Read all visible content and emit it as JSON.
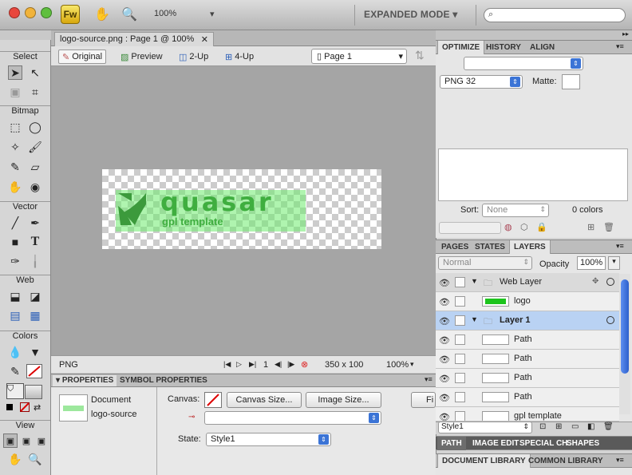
{
  "titlebar": {
    "app_logo": "Fw",
    "zoom": "100%",
    "workspace": "EXPANDED MODE ▾",
    "icons": [
      "hand-icon",
      "zoom-icon"
    ]
  },
  "toolbox": {
    "select": "Select",
    "bitmap": "Bitmap",
    "vector": "Vector",
    "web": "Web",
    "colors": "Colors",
    "view": "View"
  },
  "document": {
    "tab_title": "logo-source.png : Page 1 @ 100%",
    "views": [
      "Original",
      "Preview",
      "2-Up",
      "4-Up"
    ],
    "page": "Page 1",
    "logo_text": "quasar",
    "logo_sub": "gpl template"
  },
  "status": {
    "format": "PNG",
    "frame": "1",
    "size": "350 x 100",
    "zoom": "100%"
  },
  "properties": {
    "tabs": [
      "PROPERTIES",
      "SYMBOL PROPERTIES"
    ],
    "doc_label": "Document",
    "doc_name": "logo-source",
    "canvas_label": "Canvas:",
    "canvas_size": "Canvas Size...",
    "image_size": "Image Size...",
    "fit": "Fi",
    "state_label": "State:",
    "state_value": "Style1"
  },
  "optimize": {
    "tabs": [
      "OPTIMIZE",
      "HISTORY",
      "ALIGN"
    ],
    "format": "PNG 32",
    "matte_label": "Matte:",
    "sort_label": "Sort:",
    "sort_value": "None",
    "colors": "0 colors"
  },
  "layers_panel": {
    "tabs": [
      "PAGES",
      "STATES",
      "LAYERS"
    ],
    "blend": "Normal",
    "opacity_label": "Opacity",
    "opacity": "100%",
    "rows": [
      {
        "name": "Web Layer",
        "type": "folder"
      },
      {
        "name": "logo",
        "type": "item"
      },
      {
        "name": "Layer 1",
        "type": "folder"
      },
      {
        "name": "Path",
        "type": "item"
      },
      {
        "name": "Path",
        "type": "item"
      },
      {
        "name": "Path",
        "type": "item"
      },
      {
        "name": "Path",
        "type": "item"
      },
      {
        "name": "gpl template",
        "type": "item"
      }
    ],
    "state_select": "Style1"
  },
  "bottom_tabs": [
    "PATH",
    "IMAGE EDIT",
    "SPECIAL CH",
    "SHAPES"
  ],
  "library_tabs": [
    "DOCUMENT LIBRARY",
    "COMMON LIBRARY"
  ]
}
